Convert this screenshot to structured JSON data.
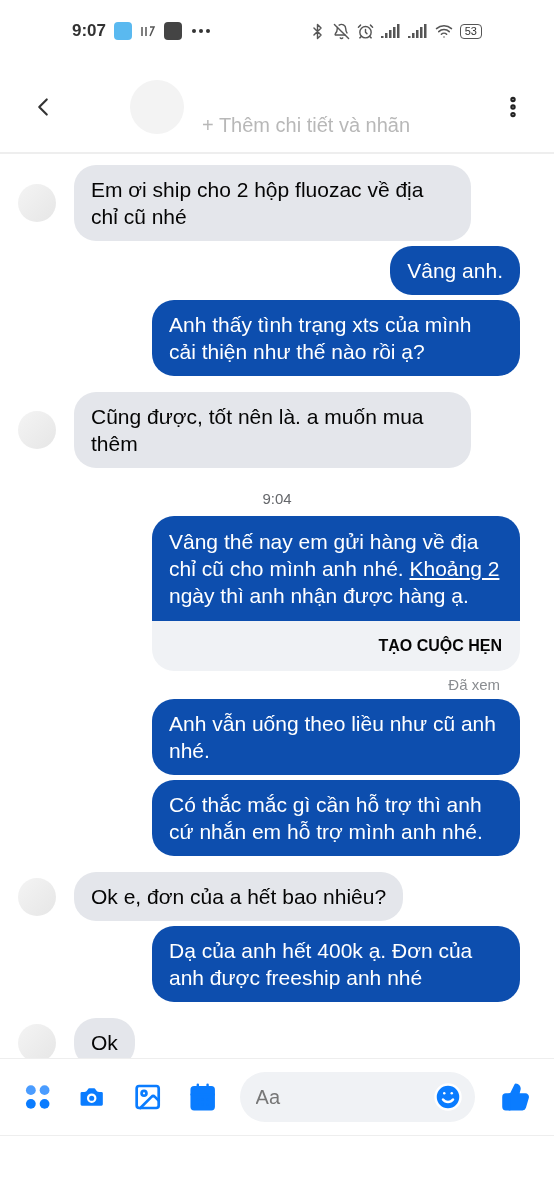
{
  "status_bar": {
    "time": "9:07",
    "battery": "53"
  },
  "header": {
    "subtitle": "+ Thêm chi tiết và nhãn"
  },
  "messages": [
    {
      "kind": "incoming",
      "parts": [
        {
          "text": "Em ơi ship cho 2 hộp fluozac về địa chỉ cũ nhé",
          "link": false
        }
      ]
    },
    {
      "kind": "outgoing",
      "parts": [
        {
          "text": "Vâng anh.",
          "link": false
        }
      ]
    },
    {
      "kind": "outgoing",
      "parts": [
        {
          "text": "Anh thấy tình trạng xts của mình cải thiện như thế nào rồi ạ?",
          "link": false
        }
      ]
    },
    {
      "kind": "incoming",
      "parts": [
        {
          "text": "Cũng được, tốt nên là. a muốn mua thêm",
          "link": false
        }
      ]
    },
    {
      "kind": "timestamp",
      "text": "9:04"
    },
    {
      "kind": "outgoing",
      "parts": [
        {
          "text": "Vâng thế nay em gửi hàng về địa chỉ cũ cho mình anh nhé. ",
          "link": false
        },
        {
          "text": "Khoảng 2",
          "link": true
        },
        {
          "text": " ngày thì anh nhận được hàng ạ.",
          "link": false
        }
      ],
      "action": "TẠO CUỘC HẸN"
    },
    {
      "kind": "seen",
      "text": "Đã xem"
    },
    {
      "kind": "outgoing",
      "parts": [
        {
          "text": "Anh vẫn uống theo liều như cũ anh nhé.",
          "link": false
        }
      ]
    },
    {
      "kind": "outgoing",
      "parts": [
        {
          "text": "Có thắc mắc gì cần hỗ trợ thì anh cứ nhắn em hỗ trợ mình anh nhé.",
          "link": false
        }
      ]
    },
    {
      "kind": "incoming",
      "parts": [
        {
          "text": "Ok e, đơn của a hết bao nhiêu?",
          "link": false
        }
      ]
    },
    {
      "kind": "outgoing",
      "parts": [
        {
          "text": "Dạ của anh hết 400k ạ. Đơn của anh được freeship anh nhé",
          "link": false
        }
      ]
    },
    {
      "kind": "incoming",
      "parts": [
        {
          "text": "Ok",
          "link": false
        }
      ]
    }
  ],
  "composer": {
    "placeholder": "Aa"
  }
}
